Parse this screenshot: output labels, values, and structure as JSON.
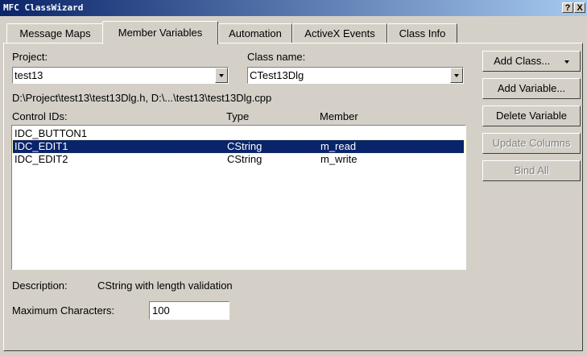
{
  "window": {
    "title": "MFC ClassWizard",
    "help_label": "?",
    "close_label": "X"
  },
  "tabs": [
    {
      "label": "Message Maps"
    },
    {
      "label": "Member Variables"
    },
    {
      "label": "Automation"
    },
    {
      "label": "ActiveX Events"
    },
    {
      "label": "Class Info"
    }
  ],
  "project": {
    "label": "Project:",
    "value": "test13"
  },
  "class_name": {
    "label": "Class name:",
    "value": "CTest13Dlg"
  },
  "path": "D:\\Project\\test13\\test13Dlg.h, D:\\...\\test13\\test13Dlg.cpp",
  "list": {
    "headers": {
      "id": "Control IDs:",
      "type": "Type",
      "member": "Member"
    },
    "rows": [
      {
        "id": "IDC_BUTTON1",
        "type": "",
        "member": ""
      },
      {
        "id": "IDC_EDIT1",
        "type": "CString",
        "member": "m_read",
        "selected": true
      },
      {
        "id": "IDC_EDIT2",
        "type": "CString",
        "member": "m_write"
      }
    ]
  },
  "description": {
    "label": "Description:",
    "value": "CString with length validation"
  },
  "max_chars": {
    "label": "Maximum Characters:",
    "value": "100"
  },
  "buttons": {
    "add_class": "Add Class...",
    "add_variable": "Add Variable...",
    "delete_variable": "Delete Variable",
    "update_columns": "Update Columns",
    "bind_all": "Bind All"
  },
  "colors": {
    "titlebar": "#0a246a",
    "selection": "#0a246a",
    "face": "#d4d0c8"
  }
}
